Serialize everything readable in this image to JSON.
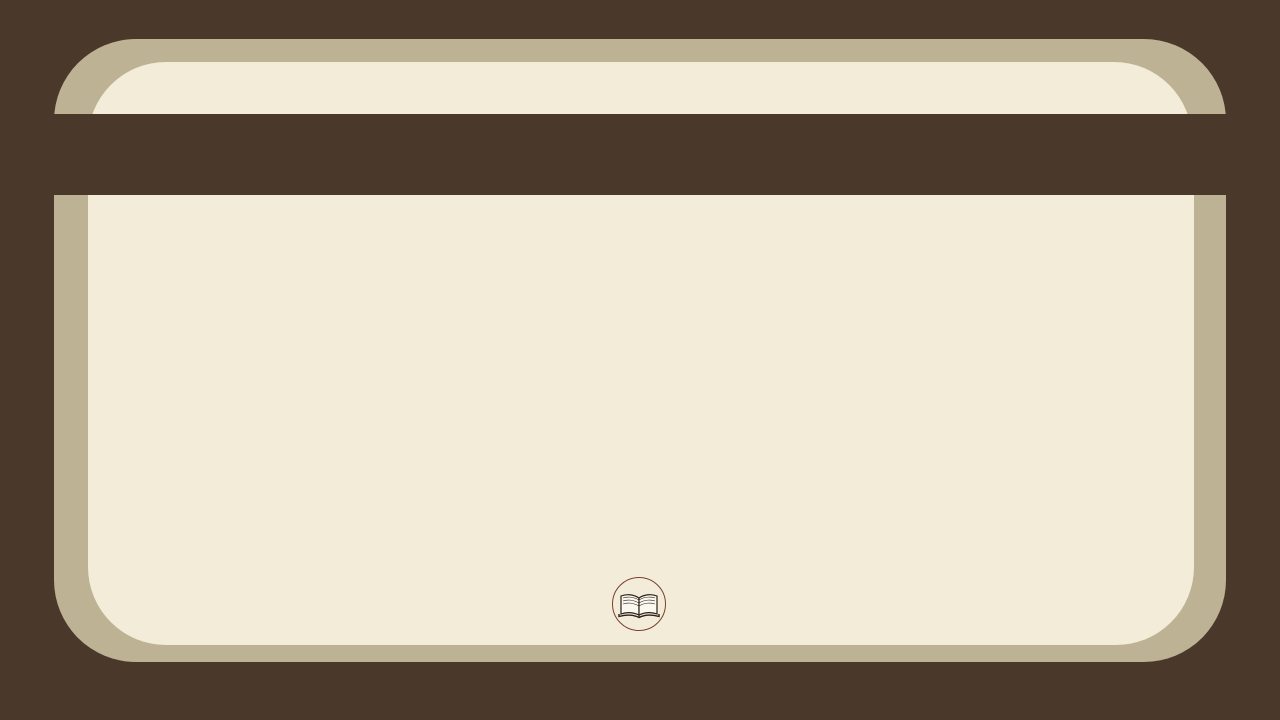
{
  "slide": {
    "title": "",
    "colors": {
      "background": "#4a382b",
      "frame": "#bdb294",
      "panel": "#f3ecd8",
      "badge_border": "#7a4030"
    },
    "icon": "open-book-icon"
  }
}
